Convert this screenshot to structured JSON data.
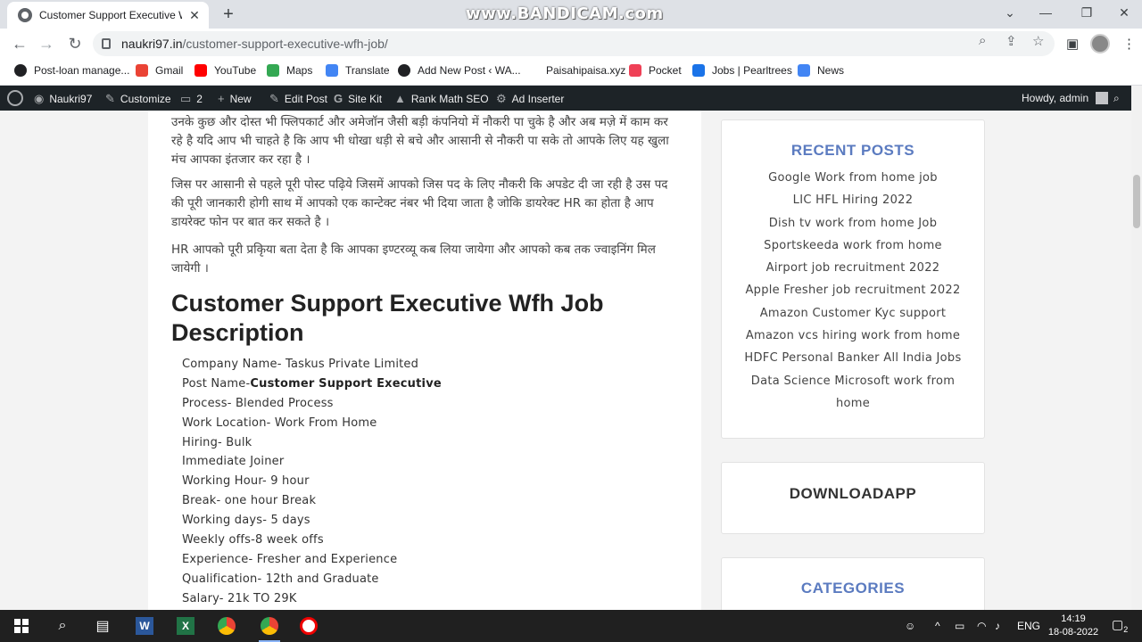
{
  "browser": {
    "tab_title": "Customer Support Executive Wfh",
    "recorder_watermark": "www.BANDICAM.com",
    "url_host": "naukri97.in",
    "url_path": "/customer-support-executive-wfh-job/"
  },
  "bookmarks": [
    {
      "label": "Post-loan manage...",
      "color": "#202124"
    },
    {
      "label": "Gmail",
      "color": "#ea4335"
    },
    {
      "label": "YouTube",
      "color": "#ff0000"
    },
    {
      "label": "Maps",
      "color": "#34a853"
    },
    {
      "label": "Translate",
      "color": "#4285f4"
    },
    {
      "label": "Add New Post ‹ WA...",
      "color": "#202124"
    },
    {
      "label": "Paisahipaisa.xyz",
      "color": "#ffffff"
    },
    {
      "label": "Pocket",
      "color": "#ef4056"
    },
    {
      "label": "Jobs | Pearltrees",
      "color": "#1a73e8"
    },
    {
      "label": "News",
      "color": "#4285f4"
    }
  ],
  "adminbar": {
    "site": "Naukri97",
    "customize": "Customize",
    "comments": "2",
    "new": "New",
    "edit_post": "Edit Post",
    "site_kit": "Site Kit",
    "rank_math": "Rank Math SEO",
    "ad_inserter": "Ad Inserter",
    "howdy": "Howdy, admin"
  },
  "article": {
    "para1": "उनके कुछ और दोस्त भी फ्लिपकार्ट और अमेजॉन जैसी बड़ी कंपनियो में नौकरी पा चुके है और अब मज़े में काम कर रहे है यदि आप भी चाहते है कि आप भी धोखा धड़ी से बचे और आसानी से नौकरी पा सके तो आपके लिए यह खुला मंच आपका इंतजार कर रहा है ।",
    "para2": "जिस पर आसानी से पहले पूरी पोस्ट पढ़िये जिसमें आपको जिस पद के लिए नौकरी कि अपडेट दी जा रही है उस पद की पूरी जानकारी होगी साथ में आपको एक कान्टेक्ट नंबर भी दिया जाता है जोकि डायरेक्ट HR का होता है आप डायरेक्ट फोन पर बात कर सकते है ।",
    "para3": "HR आपको पूरी प्रकृिया बता देता है कि आपका इण्टरव्यू कब लिया जायेगा और आपको कब तक ज्वाइनिंग मिल जायेगी ।",
    "heading": "Customer Support Executive Wfh Job Description",
    "details": [
      {
        "label": "Company Name- Taskus Private Limited",
        "bold": ""
      },
      {
        "label": "Post Name-",
        "bold": "Customer Support Executive"
      },
      {
        "label": "Process- Blended Process",
        "bold": ""
      },
      {
        "label": "Work Location- Work From Home",
        "bold": ""
      },
      {
        "label": "Hiring- Bulk",
        "bold": ""
      },
      {
        "label": "Immediate Joiner",
        "bold": ""
      },
      {
        "label": "Working Hour- 9 hour",
        "bold": ""
      },
      {
        "label": "Break- one hour Break",
        "bold": ""
      },
      {
        "label": "Working days- 5 days",
        "bold": ""
      },
      {
        "label": "Weekly offs-8 week offs",
        "bold": ""
      },
      {
        "label": "Experience- Fresher and Experience",
        "bold": ""
      },
      {
        "label": "Qualification- 12th and Graduate",
        "bold": ""
      },
      {
        "label": "Salary- 21k TO 29K",
        "bold": ""
      }
    ]
  },
  "sidebar": {
    "recent_title": "RECENT POSTS",
    "recent_title_color": "#5b7bc0",
    "recent_posts": [
      "Google Work from home job",
      "LIC HFL Hiring 2022",
      "Dish tv work from home Job",
      "Sportskeeda work from home",
      "Airport job recruitment 2022",
      "Apple Fresher job recruitment 2022",
      "Amazon Customer Kyc support",
      "Amazon vcs hiring work from home",
      "HDFC Personal Banker All India Jobs",
      "Data Science Microsoft work from",
      "home"
    ],
    "download_title": "DOWNLOADAPP",
    "categories_title": "CATEGORIES"
  },
  "taskbar": {
    "language": "ENG",
    "time": "14:19",
    "date": "18-08-2022",
    "notifications": "2"
  }
}
